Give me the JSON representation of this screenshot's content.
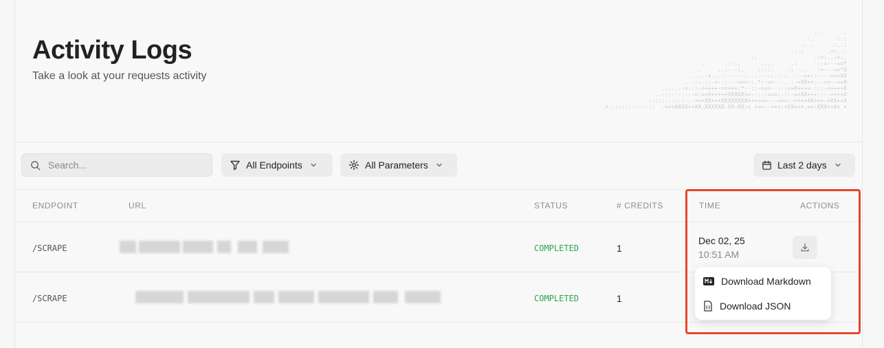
{
  "header": {
    "title": "Activity Logs",
    "subtitle": "Take a look at your requests activity"
  },
  "toolbar": {
    "search_placeholder": "Search...",
    "endpoints_filter": "All Endpoints",
    "parameters_filter": "All Parameters",
    "date_range": "Last 2 days"
  },
  "table": {
    "columns": [
      "ENDPOINT",
      "URL",
      "STATUS",
      "# CREDITS",
      "TIME",
      "ACTIONS"
    ],
    "rows": [
      {
        "endpoint": "/SCRAPE",
        "status": "COMPLETED",
        "credits": "1",
        "date": "Dec 02, 25",
        "time": "10:51 AM"
      },
      {
        "endpoint": "/SCRAPE",
        "status": "COMPLETED",
        "credits": "1"
      }
    ]
  },
  "download_menu": {
    "markdown_label": "Download Markdown",
    "json_label": "Download JSON"
  },
  "colors": {
    "status_completed": "#2ea44f",
    "highlight_border": "#e8452c"
  }
}
